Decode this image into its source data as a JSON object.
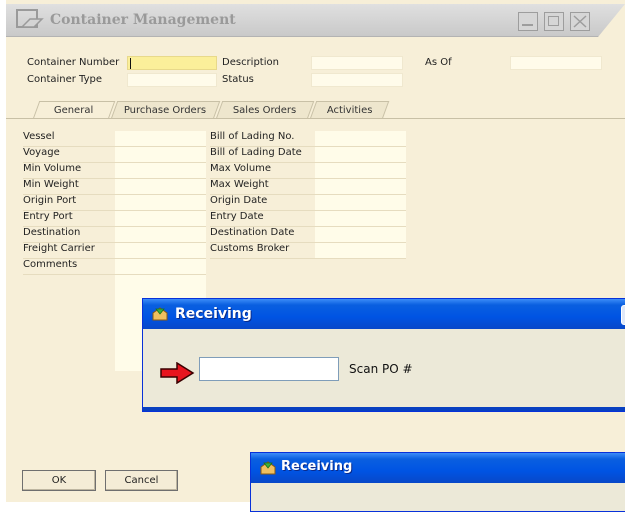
{
  "window": {
    "title": "Container Management"
  },
  "header": {
    "container_number_label": "Container Number",
    "container_number_value": "",
    "container_type_label": "Container Type",
    "container_type_value": "",
    "description_label": "Description",
    "description_value": "",
    "status_label": "Status",
    "status_value": "",
    "as_of_label": "As Of",
    "as_of_value": ""
  },
  "tabs": [
    {
      "label": "General"
    },
    {
      "label": "Purchase Orders"
    },
    {
      "label": "Sales Orders"
    },
    {
      "label": "Activities"
    }
  ],
  "general": {
    "left_labels": [
      "Vessel",
      "Voyage",
      "Min Volume",
      "Min Weight",
      "Origin Port",
      "Entry Port",
      "Destination",
      "Freight Carrier",
      "Comments"
    ],
    "right_labels": [
      "Bill of Lading No.",
      "Bill of Lading Date",
      "Max Volume",
      "Max Weight",
      "Origin Date",
      "Entry Date",
      "Destination Date",
      "Customs Broker"
    ]
  },
  "buttons": {
    "ok": "OK",
    "cancel": "Cancel"
  },
  "receiving_dialog": {
    "title": "Receiving",
    "scan_input_value": "",
    "scan_label": "Scan PO #"
  },
  "receiving_dialog_2": {
    "title": "Receiving"
  },
  "colors": {
    "window_bg": "#f7efd8",
    "active_field": "#fbef9a",
    "xp_title_blue": "#0054e3",
    "arrow_red": "#e8141e"
  }
}
